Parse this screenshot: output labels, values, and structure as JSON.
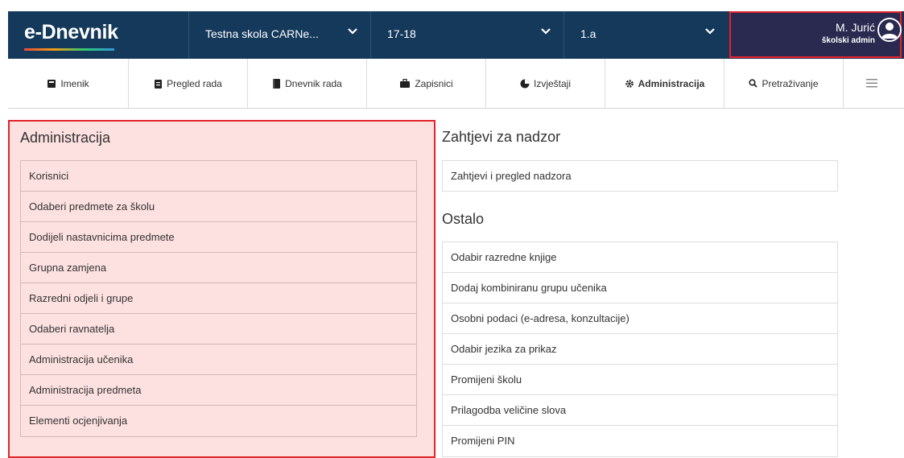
{
  "app": {
    "logo": "e-Dnevnik"
  },
  "selectors": {
    "school": "Testna skola CARNe...",
    "year": "17-18",
    "class": "1.a"
  },
  "user": {
    "name": "M. Jurić",
    "role": "školski admin"
  },
  "nav": {
    "tabs": [
      {
        "label": "Imenik",
        "icon": "book-icon"
      },
      {
        "label": "Pregled rada",
        "icon": "clipboard-icon"
      },
      {
        "label": "Dnevnik rada",
        "icon": "notebook-icon"
      },
      {
        "label": "Zapisnici",
        "icon": "briefcase-icon"
      },
      {
        "label": "Izvještaji",
        "icon": "pie-chart-icon"
      },
      {
        "label": "Administracija",
        "icon": "gear-icon"
      },
      {
        "label": "Pretraživanje",
        "icon": "search-icon"
      },
      {
        "label": "",
        "icon": "hamburger-menu-icon"
      }
    ],
    "active_tab": "Administracija"
  },
  "admin": {
    "title": "Administracija",
    "items": [
      "Korisnici",
      "Odaberi predmete za školu",
      "Dodijeli nastavnicima predmete",
      "Grupna zamjena",
      "Razredni odjeli i grupe",
      "Odaberi ravnatelja",
      "Administracija učenika",
      "Administracija predmeta",
      "Elementi ocjenjivanja"
    ]
  },
  "supervision": {
    "title": "Zahtjevi za nadzor",
    "items": [
      "Zahtjevi i pregled nadzora"
    ]
  },
  "other": {
    "title": "Ostalo",
    "items": [
      "Odabir razredne knjige",
      "Dodaj kombiniranu grupu učenika",
      "Osobni podaci (e-adresa, konzultacije)",
      "Odabir jezika za prikaz",
      "Promijeni školu",
      "Prilagodba veličine slova",
      "Promijeni PIN"
    ]
  },
  "colors": {
    "header": "#14395b",
    "highlight_border": "#e0242c",
    "highlight_fill": "#fde0e0"
  }
}
